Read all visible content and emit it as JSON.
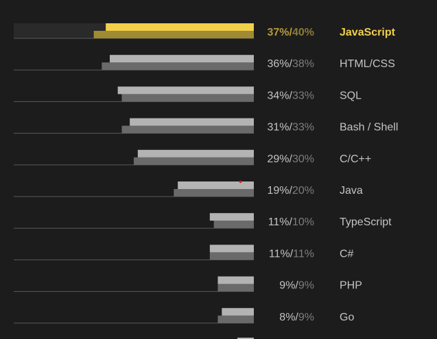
{
  "chart_data": {
    "type": "bar",
    "orientation": "horizontal",
    "grid": false,
    "categories": [
      "JavaScript",
      "HTML/CSS",
      "SQL",
      "Bash / Shell",
      "C/C++",
      "Java",
      "TypeScript",
      "C#",
      "PHP",
      "Go"
    ],
    "highlighted_category": "JavaScript",
    "series": [
      {
        "values": [
          37,
          36,
          34,
          31,
          29,
          19,
          11,
          11,
          9,
          8
        ]
      },
      {
        "values": [
          40,
          38,
          33,
          33,
          30,
          20,
          10,
          11,
          9,
          9
        ]
      }
    ],
    "labels": [
      "37%/40%",
      "36%/38%",
      "34%/33%",
      "31%/33%",
      "29%/30%",
      "19%/20%",
      "11%/10%",
      "11%/11%",
      "9%/9%",
      "8%/9%"
    ],
    "value_max": 60,
    "colors": {
      "background": "#1c1c1c",
      "highlight_series_1": "#f2d04b",
      "highlight_series_2": "#a08a32",
      "series_1": "#b3b3b3",
      "series_2": "#6a6a6a",
      "baseline": "#5a5a5a",
      "highlight_track": "#2a2a2a",
      "highlight_text_1": "#b39a3c",
      "highlight_text_2": "#8a7a3a",
      "label_text_1": "#c4c4c4",
      "label_text_2": "#7e7e7e",
      "highlight_lang": "#f2d04b",
      "lang_text": "#c4c4c4",
      "marker": "#e02020"
    }
  }
}
